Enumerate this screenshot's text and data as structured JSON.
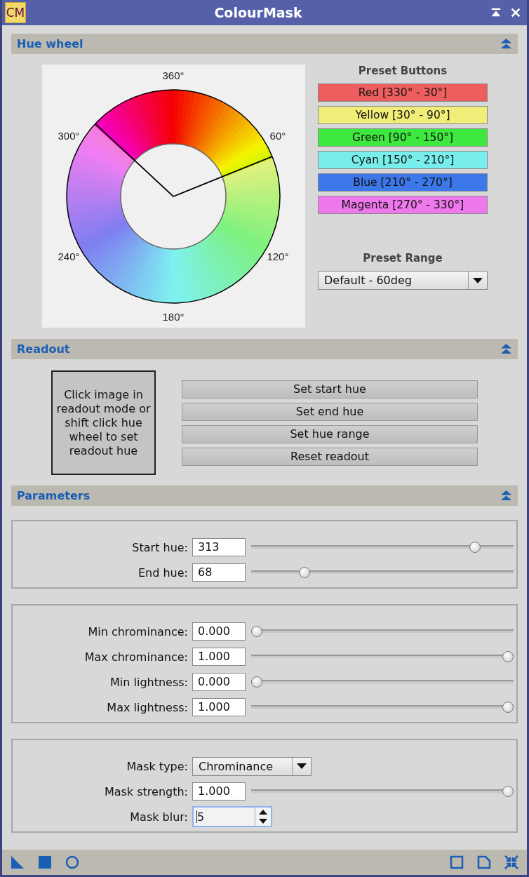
{
  "window": {
    "title": "ColourMask",
    "app_icon": "CM"
  },
  "hue_wheel": {
    "title": "Hue wheel",
    "expanded": true,
    "angle_labels": [
      "360°",
      "60°",
      "120°",
      "180°",
      "240°",
      "300°"
    ],
    "preset_buttons_title": "Preset Buttons",
    "presets": [
      {
        "label": "Red [330° - 30°]",
        "color": "#ee5e5e"
      },
      {
        "label": "Yellow [30° - 90°]",
        "color": "#f0ee78"
      },
      {
        "label": "Green [90° - 150°]",
        "color": "#3ee83e"
      },
      {
        "label": "Cyan [150° - 210°]",
        "color": "#78eeec"
      },
      {
        "label": "Blue [210° - 270°]",
        "color": "#3c78ea"
      },
      {
        "label": "Magenta [270° - 330°]",
        "color": "#ee78ec"
      }
    ],
    "preset_range_title": "Preset Range",
    "preset_range": "Default - 60deg"
  },
  "readout": {
    "title": "Readout",
    "expanded": true,
    "hint": "Click image in readout mode or shift click hue wheel to set readout hue",
    "buttons": [
      "Set start hue",
      "Set end hue",
      "Set hue range",
      "Reset readout"
    ]
  },
  "parameters": {
    "title": "Parameters",
    "expanded": true,
    "groups": [
      [
        {
          "kind": "slider",
          "label": "Start hue:",
          "value": "313",
          "level": 0.87
        },
        {
          "kind": "slider",
          "label": "End hue:",
          "value": "68",
          "level": 0.19
        }
      ],
      [
        {
          "kind": "slider",
          "label": "Min chrominance:",
          "value": "0.000",
          "level": 0
        },
        {
          "kind": "slider",
          "label": "Max chrominance:",
          "value": "1.000",
          "level": 1
        },
        {
          "kind": "slider",
          "label": "Min lightness:",
          "value": "0.000",
          "level": 0
        },
        {
          "kind": "slider",
          "label": "Max lightness:",
          "value": "1.000",
          "level": 1
        }
      ],
      [
        {
          "kind": "dropdown",
          "label": "Mask type:",
          "value": "Chrominance"
        },
        {
          "kind": "slider",
          "label": "Mask strength:",
          "value": "1.000",
          "level": 1
        },
        {
          "kind": "spin",
          "label": "Mask blur:",
          "value": "5",
          "focused": true
        }
      ]
    ]
  }
}
